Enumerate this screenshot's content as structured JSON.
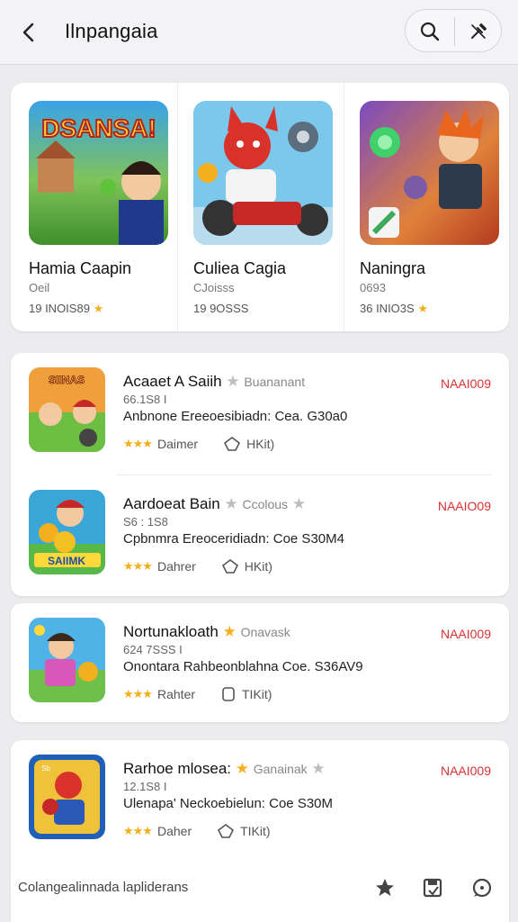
{
  "header": {
    "title": "Ilnpangaia",
    "back_icon": "chevron-left-icon",
    "search_icon": "search-icon",
    "tools_icon": "wrench-icon"
  },
  "featured": [
    {
      "name": "Hamia Caapin",
      "sub": "Oeil",
      "rating": "19 INOIS89",
      "art_text": "DSANSA!"
    },
    {
      "name": "Culiea Cagia",
      "sub": "CJoisss",
      "rating": "19 9OSSS",
      "art_text": ""
    },
    {
      "name": "Naningra",
      "sub": "0693",
      "rating": "36 INIO3S",
      "art_text": ""
    }
  ],
  "list": [
    {
      "name": "Acaaet A Saiih",
      "tag": "Buananant",
      "sub": "66.1S8 I",
      "desc": "Anbnone Ereeoesibiadn: Cea. G30a0",
      "meta_label": "Daimer",
      "meta_extra": "HKit)",
      "price": "NAAI009",
      "icon_text": "SIINAS"
    },
    {
      "name": "Aardoeat Bain",
      "tag": "Ccolous",
      "sub": "S6 : 1S8",
      "desc": "Cpbnmra Ereoceridiadn: Coe S30M4",
      "meta_label": "Dahrer",
      "meta_extra": "HKit)",
      "price": "NAAIO09",
      "icon_text": "SAIIMK"
    },
    {
      "name": "Nortunakloath",
      "tag": "Onavask",
      "sub": "624 7SSS I",
      "desc": "Onontara Rahbeonblahna Coe. S36AV9",
      "meta_label": "Rahter",
      "meta_extra": "TIKit)",
      "price": "NAAI009",
      "icon_text": ""
    },
    {
      "name": "Rarhoe mlosea:",
      "tag": "Ganainak",
      "sub": "12.1S8 I",
      "desc": "Ulenapa' Neckoebielun: Coe S30M",
      "meta_label": "Daher",
      "meta_extra": "TIKit)",
      "price": "NAAI009",
      "icon_text": ""
    }
  ],
  "bottom": {
    "text": "Colangealinnada lapliderans",
    "star_icon": "star-icon",
    "save_icon": "save-icon",
    "chat_icon": "chat-icon"
  }
}
